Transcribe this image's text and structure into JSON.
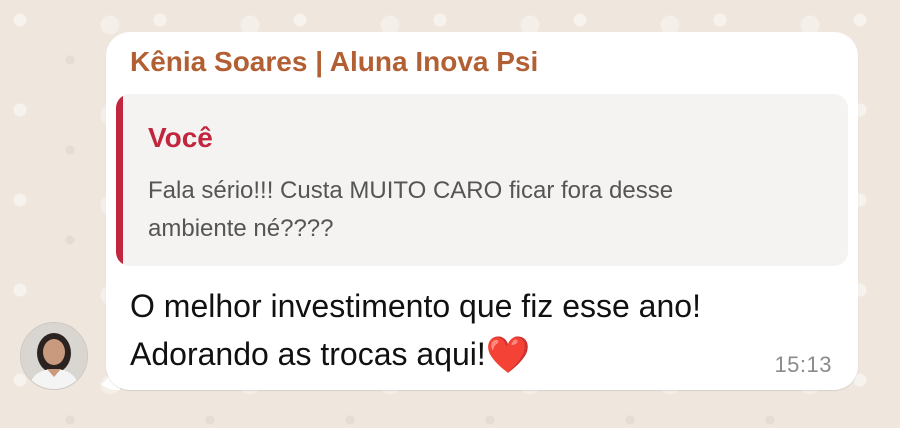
{
  "chat": {
    "sender_name": "Kênia Soares | Aluna Inova Psi",
    "sender_color": "#B25F33",
    "quoted": {
      "author": "Você",
      "author_color": "#C2263F",
      "text": "Fala sério!!! Custa MUITO CARO ficar fora desse ambiente né????"
    },
    "message": {
      "line1": "O melhor investimento que fiz esse ano!",
      "line2": "Adorando as trocas aqui!",
      "emoji": "❤️",
      "emoji_name": "red-heart",
      "time": "15:13"
    },
    "avatar_icon": "profile-photo"
  }
}
